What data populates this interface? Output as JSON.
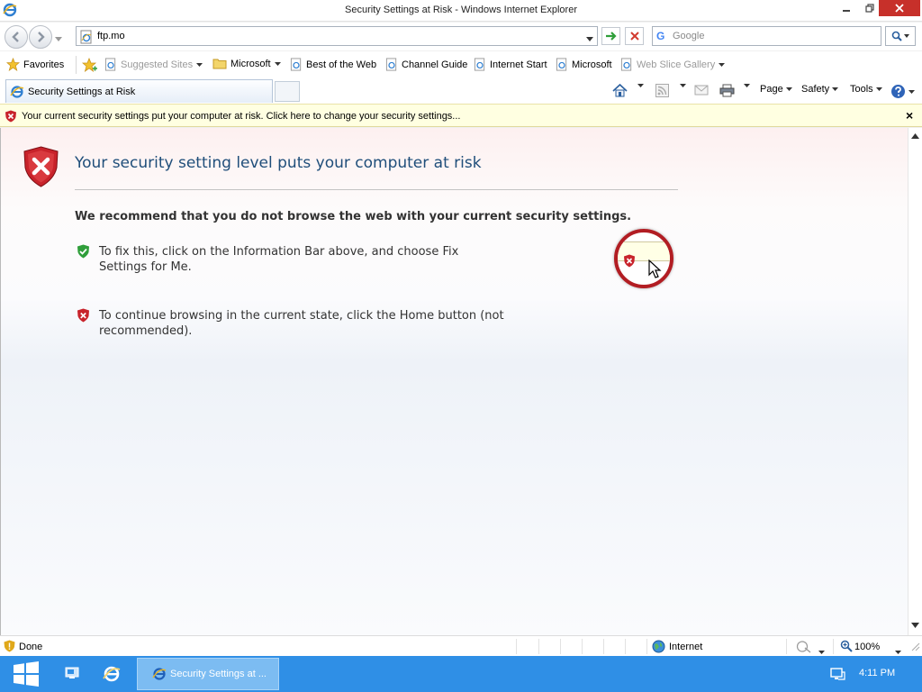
{
  "window": {
    "title": "Security Settings at Risk - Windows Internet Explorer"
  },
  "navbar": {
    "address_value": "ftp.mo",
    "search_placeholder": "Google",
    "search_logo": "G"
  },
  "favorites": {
    "favorites_label": "Favorites",
    "items": [
      {
        "label": "Suggested Sites",
        "icon": "ie-page-icon"
      },
      {
        "label": "Microsoft",
        "icon": "folder-icon"
      },
      {
        "label": "Best of the Web",
        "icon": "ie-page-icon"
      },
      {
        "label": "Channel Guide",
        "icon": "ie-page-icon"
      },
      {
        "label": "Internet Start",
        "icon": "ie-page-icon"
      },
      {
        "label": "Microsoft",
        "icon": "ie-page-icon"
      },
      {
        "label": "Web Slice Gallery",
        "icon": "ie-page-icon"
      }
    ]
  },
  "tabs": {
    "active_label": "Security Settings at Risk"
  },
  "commandbar": {
    "page_label": "Page",
    "safety_label": "Safety",
    "tools_label": "Tools"
  },
  "infobar": {
    "text": "Your current security settings put your computer at risk. Click here to change your security settings...",
    "close_glyph": "×"
  },
  "content": {
    "title": "Your security setting level puts your computer at risk",
    "recommendation": "We recommend that you do not browse the web with your current security settings.",
    "fix_line1": "To fix this, click on the Information Bar above, and choose Fix",
    "fix_line2": "Settings for Me.",
    "continue_line1": "To continue browsing in the current state, click the Home button (not",
    "continue_line2": "recommended)."
  },
  "statusbar": {
    "status": "Done",
    "zone": "Internet",
    "zoom": "100%"
  },
  "taskbar": {
    "task_label": "Security Settings at ...",
    "clock": "4:11 PM"
  },
  "colors": {
    "title_blue": "#1f4e7a",
    "infobar_bg": "#ffffe1",
    "shield_red": "#c8232b",
    "shield_green": "#2f9e3a",
    "taskbar_blue": "#2f8fe6",
    "callout_red": "#b21d23"
  }
}
